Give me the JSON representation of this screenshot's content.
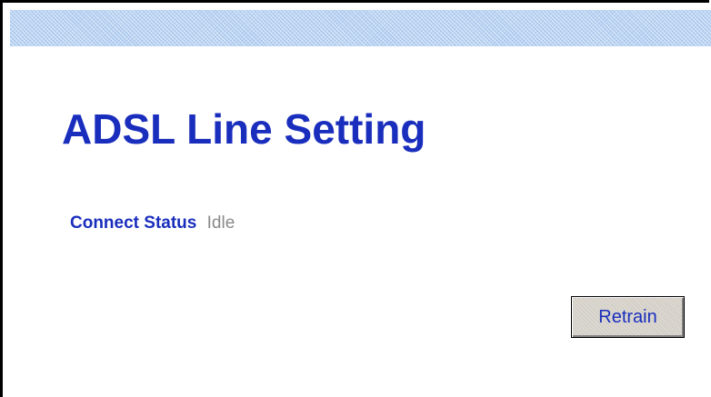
{
  "page": {
    "title": "ADSL Line Setting"
  },
  "status": {
    "label": "Connect Status",
    "value": "Idle"
  },
  "actions": {
    "retrain_label": "Retrain"
  },
  "colors": {
    "title_blue": "#1a2ebd",
    "status_value_gray": "#8a8a8a",
    "banner_blue": "#b9d3f2",
    "button_face": "#d4d0c8"
  }
}
